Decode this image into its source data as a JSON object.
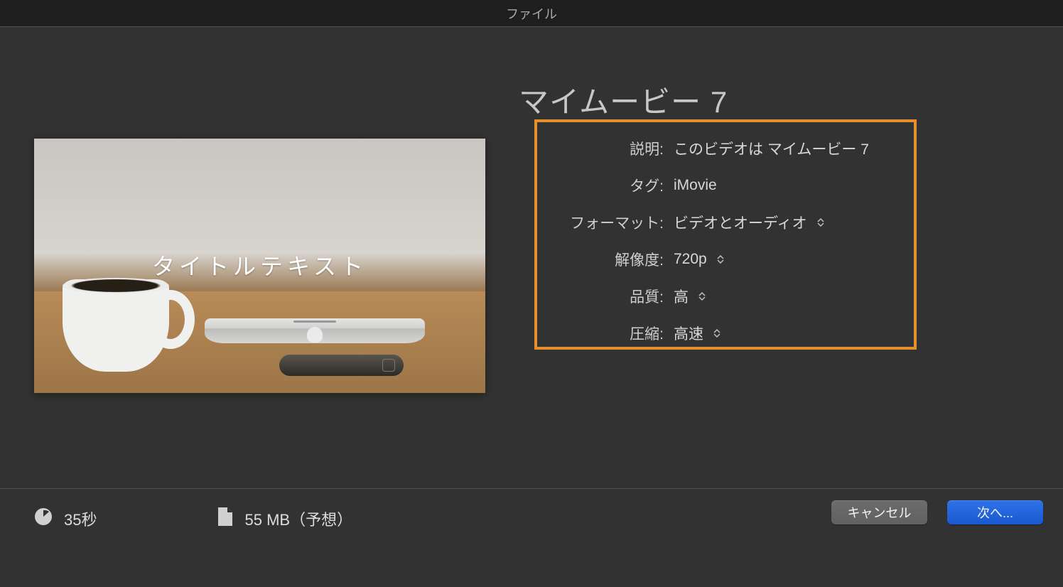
{
  "window": {
    "title": "ファイル"
  },
  "movie": {
    "title": "マイムービー 7"
  },
  "preview": {
    "overlay_text": "タイトルテキスト"
  },
  "settings": {
    "description": {
      "label": "説明:",
      "value": "このビデオは マイムービー 7"
    },
    "tag": {
      "label": "タグ:",
      "value": "iMovie"
    },
    "format": {
      "label": "フォーマット:",
      "value": "ビデオとオーディオ"
    },
    "resolution": {
      "label": "解像度:",
      "value": "720p"
    },
    "quality": {
      "label": "品質:",
      "value": "高"
    },
    "compression": {
      "label": "圧縮:",
      "value": "高速"
    }
  },
  "footer": {
    "duration": "35秒",
    "filesize": "55 MB（予想）"
  },
  "buttons": {
    "cancel": "キャンセル",
    "next": "次へ..."
  }
}
